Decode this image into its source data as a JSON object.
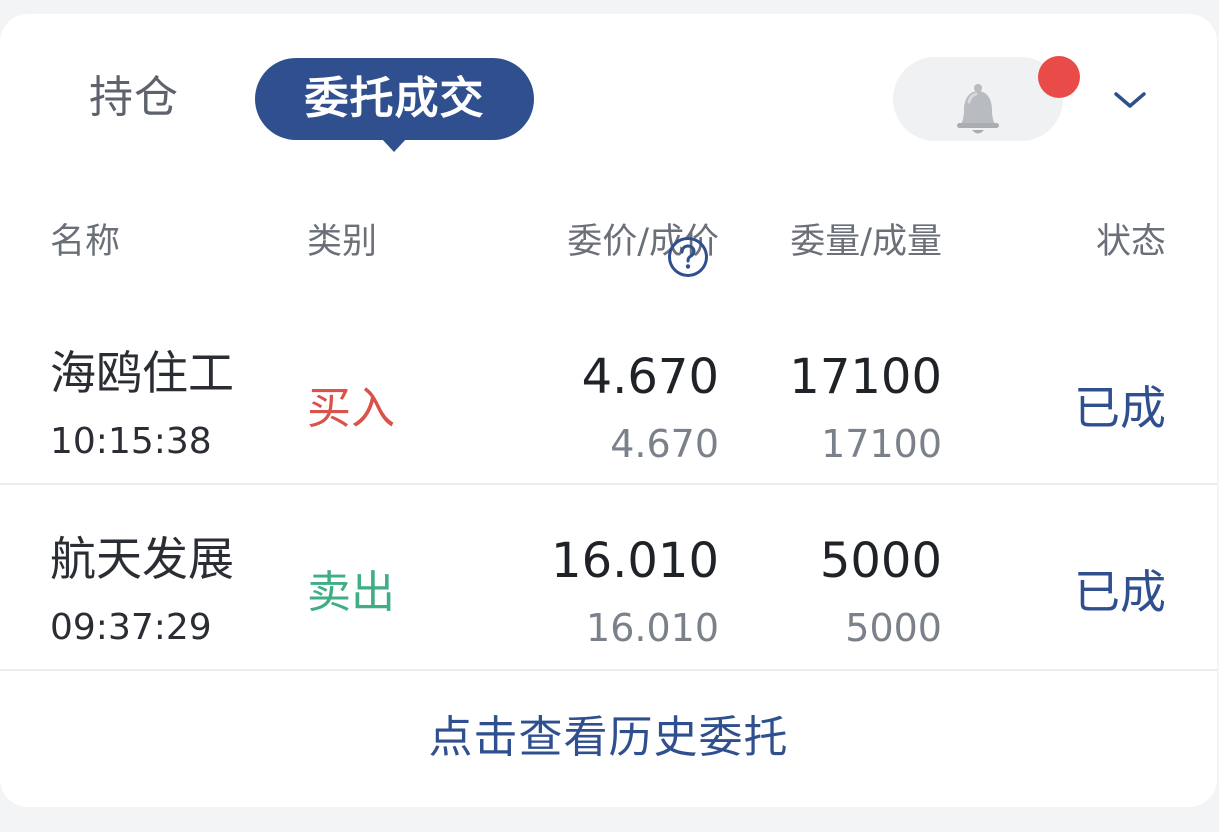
{
  "tabs": {
    "holdings": "持仓",
    "orders": "委托成交"
  },
  "icons": {
    "bell": "bell-icon",
    "notification_dot": "notification-dot",
    "expand": "chevron-down-icon",
    "help": "question-circle-icon"
  },
  "colors": {
    "accent": "#2f4f8f",
    "buy": "#d9534a",
    "sell": "#3fae84",
    "dot": "#e94b48"
  },
  "headers": {
    "name": "名称",
    "type": "类别",
    "price": "委价/成价",
    "qty": "委量/成量",
    "status": "状态"
  },
  "orders": [
    {
      "name": "海鸥住工",
      "time": "10:15:38",
      "side": "买入",
      "order_price": "4.670",
      "fill_price": "4.670",
      "order_qty": "17100",
      "fill_qty": "17100",
      "status": "已成"
    },
    {
      "name": "航天发展",
      "time": "09:37:29",
      "side": "卖出",
      "order_price": "16.010",
      "fill_price": "16.010",
      "order_qty": "5000",
      "fill_qty": "5000",
      "status": "已成"
    }
  ],
  "footer": {
    "history_link": "点击查看历史委托"
  }
}
